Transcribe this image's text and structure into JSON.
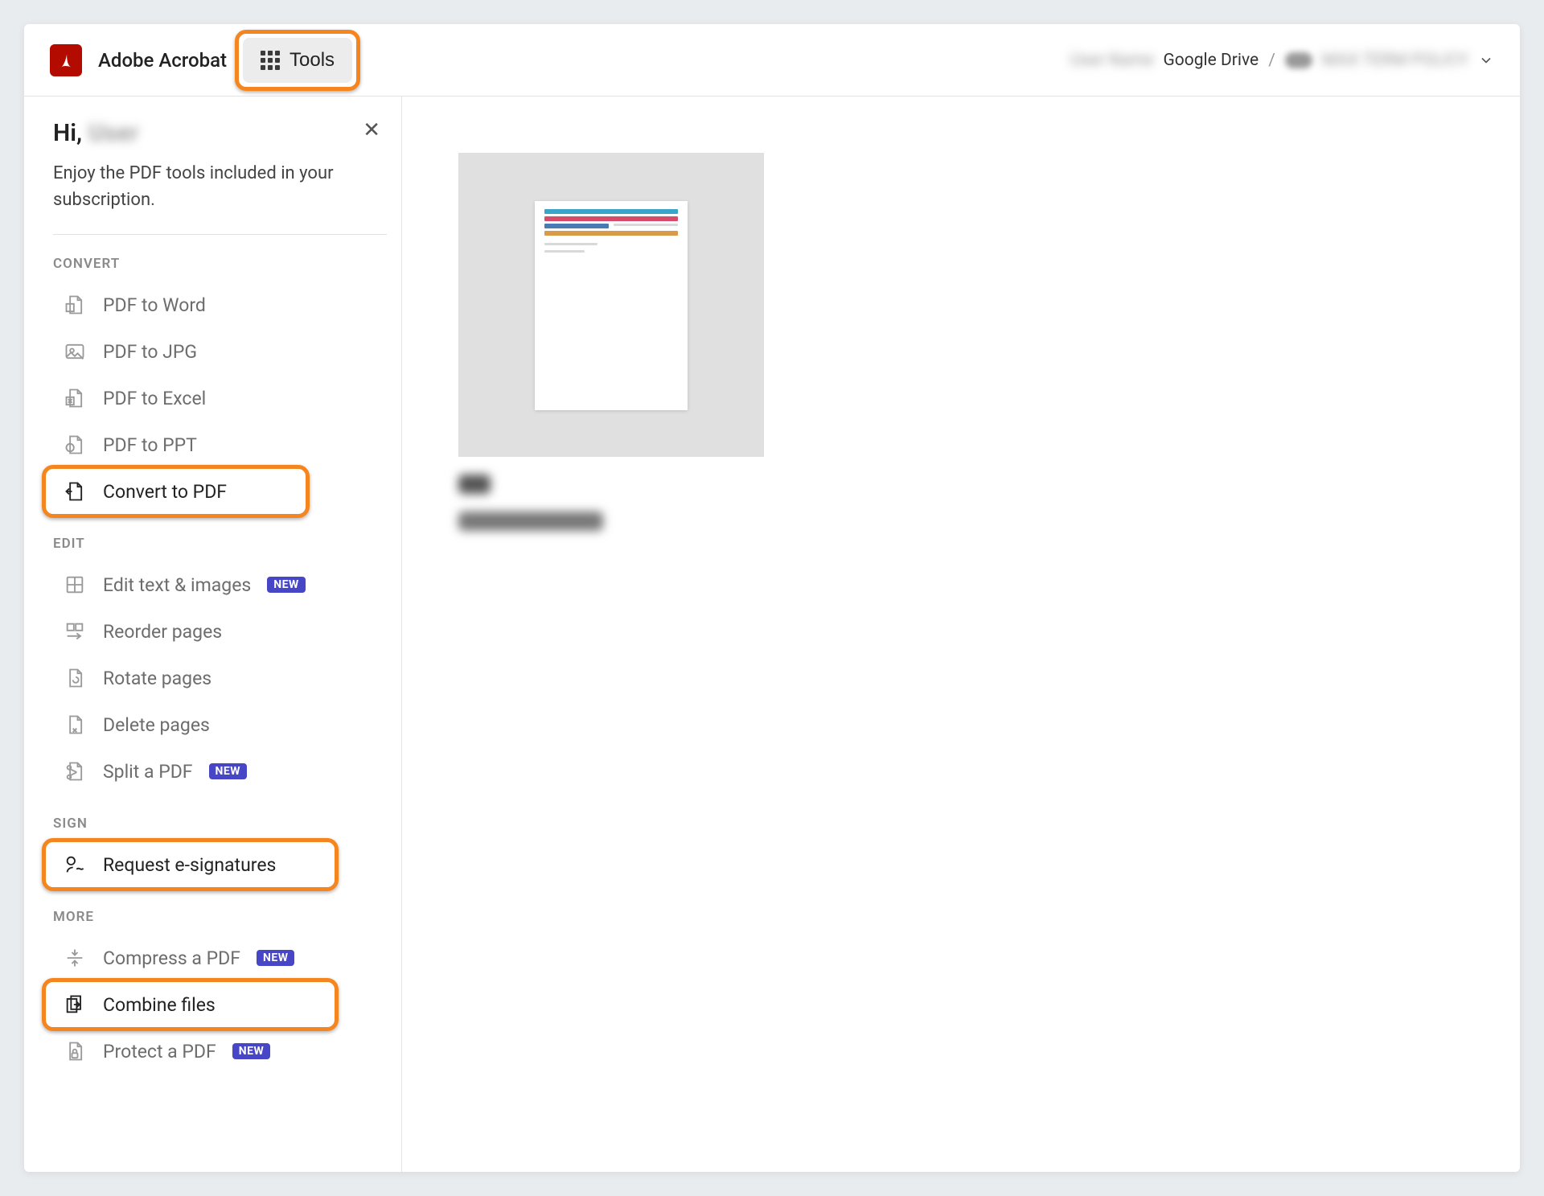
{
  "header": {
    "app_title": "Adobe Acrobat",
    "tools_label": "Tools",
    "breadcrumbs": {
      "blur1": "User Name",
      "service": "Google Drive",
      "sep": "/",
      "blur2": "MAX TERM POLICY"
    }
  },
  "sidebar": {
    "greeting_prefix": "Hi,",
    "greeting_name": "User",
    "subtext": "Enjoy the PDF tools included in your subscription.",
    "sections": {
      "convert": {
        "label": "CONVERT",
        "items": [
          {
            "label": "PDF to Word"
          },
          {
            "label": "PDF to JPG"
          },
          {
            "label": "PDF to Excel"
          },
          {
            "label": "PDF to PPT"
          },
          {
            "label": "Convert to PDF"
          }
        ]
      },
      "edit": {
        "label": "EDIT",
        "items": [
          {
            "label": "Edit text & images",
            "badge": "NEW"
          },
          {
            "label": "Reorder pages"
          },
          {
            "label": "Rotate pages"
          },
          {
            "label": "Delete pages"
          },
          {
            "label": "Split a PDF",
            "badge": "NEW"
          }
        ]
      },
      "sign": {
        "label": "SIGN",
        "items": [
          {
            "label": "Request e-signatures"
          }
        ]
      },
      "more": {
        "label": "MORE",
        "items": [
          {
            "label": "Compress a PDF",
            "badge": "NEW"
          },
          {
            "label": "Combine files"
          },
          {
            "label": "Protect a PDF",
            "badge": "NEW"
          }
        ]
      }
    }
  },
  "main": {
    "doc_line1": "A3",
    "doc_line2": "MAX TERM POLICY"
  }
}
